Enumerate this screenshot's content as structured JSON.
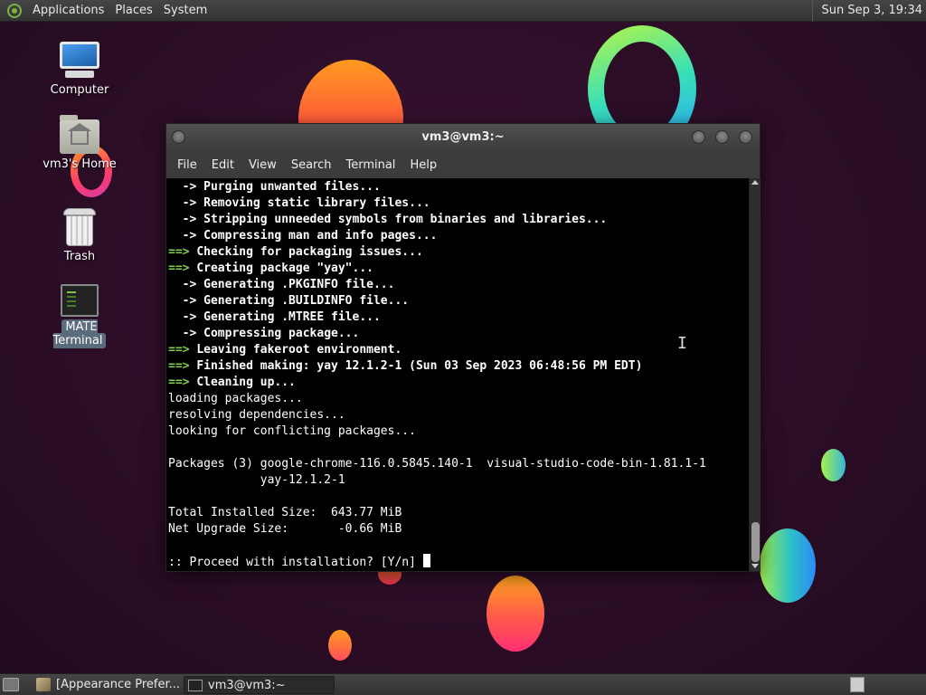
{
  "top_panel": {
    "menus": [
      "Applications",
      "Places",
      "System"
    ],
    "clock": "Sun Sep 3, 19:34"
  },
  "desktop": {
    "icons": [
      {
        "label": "Computer",
        "icon": "computer-icon"
      },
      {
        "label": "vm3's Home",
        "icon": "home-folder-icon"
      },
      {
        "label": "Trash",
        "icon": "trash-icon"
      },
      {
        "label": "MATE Terminal",
        "icon": "terminal-icon"
      }
    ]
  },
  "window": {
    "title": "vm3@vm3:~",
    "menu": [
      "File",
      "Edit",
      "View",
      "Search",
      "Terminal",
      "Help"
    ],
    "terminal_lines": [
      {
        "prefix": "  -> ",
        "text": "Purging unwanted files...",
        "style": "arrow"
      },
      {
        "prefix": "  -> ",
        "text": "Removing static library files...",
        "style": "arrow"
      },
      {
        "prefix": "  -> ",
        "text": "Stripping unneeded symbols from binaries and libraries...",
        "style": "arrow"
      },
      {
        "prefix": "  -> ",
        "text": "Compressing man and info pages...",
        "style": "arrow"
      },
      {
        "prefix": "==> ",
        "text": "Checking for packaging issues...",
        "style": "major"
      },
      {
        "prefix": "==> ",
        "text": "Creating package \"yay\"...",
        "style": "major"
      },
      {
        "prefix": "  -> ",
        "text": "Generating .PKGINFO file...",
        "style": "arrow"
      },
      {
        "prefix": "  -> ",
        "text": "Generating .BUILDINFO file...",
        "style": "arrow"
      },
      {
        "prefix": "  -> ",
        "text": "Generating .MTREE file...",
        "style": "arrow"
      },
      {
        "prefix": "  -> ",
        "text": "Compressing package...",
        "style": "arrow"
      },
      {
        "prefix": "==> ",
        "text": "Leaving fakeroot environment.",
        "style": "major"
      },
      {
        "prefix": "==> ",
        "text": "Finished making: yay 12.1.2-1 (Sun 03 Sep 2023 06:48:56 PM EDT)",
        "style": "major"
      },
      {
        "prefix": "==> ",
        "text": "Cleaning up...",
        "style": "major"
      },
      {
        "prefix": "",
        "text": "loading packages...",
        "style": "plain"
      },
      {
        "prefix": "",
        "text": "resolving dependencies...",
        "style": "plain"
      },
      {
        "prefix": "",
        "text": "looking for conflicting packages...",
        "style": "plain"
      },
      {
        "prefix": "",
        "text": "",
        "style": "plain"
      },
      {
        "prefix": "",
        "text": "Packages (3) google-chrome-116.0.5845.140-1  visual-studio-code-bin-1.81.1-1",
        "style": "plain"
      },
      {
        "prefix": "",
        "text": "             yay-12.1.2-1",
        "style": "plain"
      },
      {
        "prefix": "",
        "text": "",
        "style": "plain"
      },
      {
        "prefix": "",
        "text": "Total Installed Size:  643.77 MiB",
        "style": "plain"
      },
      {
        "prefix": "",
        "text": "Net Upgrade Size:       -0.66 MiB",
        "style": "plain"
      },
      {
        "prefix": "",
        "text": "",
        "style": "plain"
      },
      {
        "prefix": "",
        "text": ":: Proceed with installation? [Y/n] ",
        "style": "prompt"
      }
    ]
  },
  "bottom_panel": {
    "tasks": [
      {
        "label": "[Appearance Prefer...",
        "icon": "appearance-icon"
      },
      {
        "label": "vm3@vm3:~",
        "icon": "terminal-icon"
      }
    ]
  }
}
